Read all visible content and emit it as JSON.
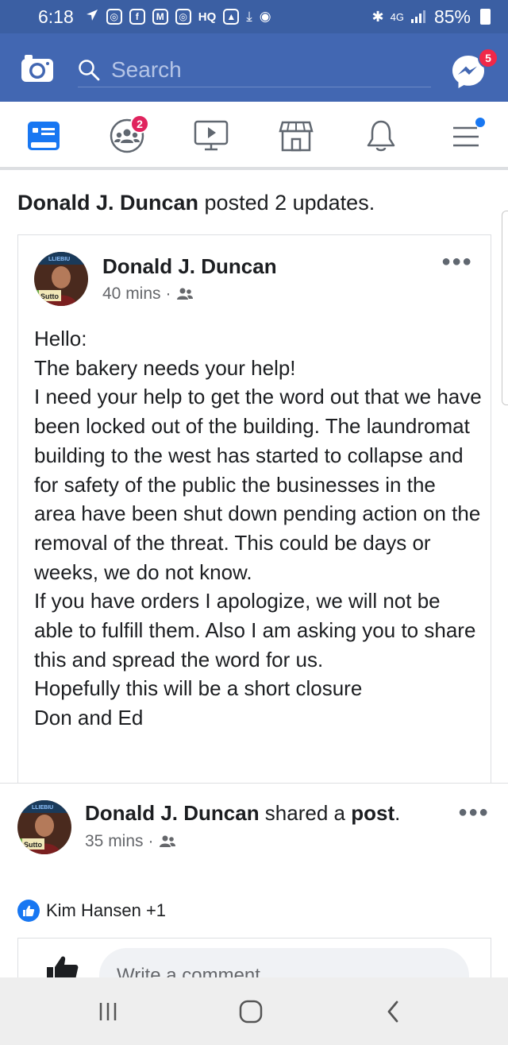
{
  "status_bar": {
    "time": "6:18",
    "hq_label": "HQ",
    "network": "4G",
    "battery": "85%"
  },
  "header": {
    "search_placeholder": "Search",
    "messenger_badge": "5"
  },
  "tabs": {
    "groups_badge": "2"
  },
  "feed": {
    "summary": {
      "name": "Donald J. Duncan",
      "text": " posted 2 updates."
    },
    "post1": {
      "author": "Donald J. Duncan",
      "time": "40 mins",
      "separator": "·",
      "avatar_text": "Sutto",
      "avatar_banner": "LLIEBIU",
      "body": "Hello:\nThe bakery needs your help!\nI need your help to get the word out that we have been locked out of the building. The laundromat  building to the west has started to collapse and for safety of the public the businesses in the area have been shut down pending action on the removal of the threat. This could be days or weeks, we do not know.\nIf you have orders I apologize, we will not be able to fulfill them. Also I am asking you to share this and spread the word for us.\nHopefully this will be a short closure\nDon and Ed"
    },
    "post2": {
      "author": "Donald J. Duncan",
      "action_text": " shared a ",
      "object": "post",
      "period": ".",
      "time": "35 mins",
      "separator": "·",
      "avatar_text": "Sutto",
      "avatar_banner": "LLIEBIU",
      "reactions": "Kim Hansen +1",
      "comment_placeholder": "Write a comment"
    }
  },
  "colors": {
    "status_bar": "#3b5fa3",
    "header": "#4267b2",
    "badge": "#f02849",
    "like_blue": "#1877f2"
  }
}
